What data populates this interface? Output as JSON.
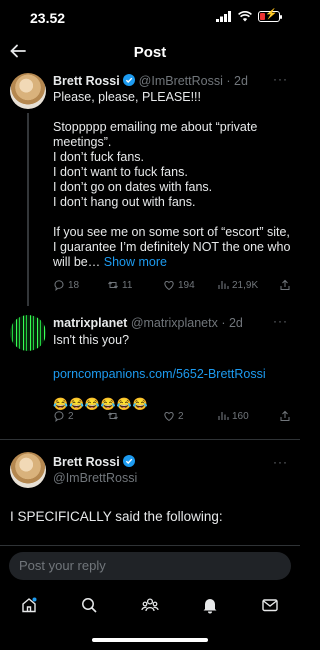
{
  "status": {
    "time": "23.52"
  },
  "header": {
    "title": "Post"
  },
  "post1": {
    "name": "Brett Rossi",
    "handle": "@ImBrettRossi",
    "time": "· 2d",
    "lines": [
      "Please, please, PLEASE!!!",
      "",
      "Stoppppp emailing me about “private",
      "meetings”.",
      "I don’t fuck fans.",
      "I don’t want to fuck fans.",
      "I don’t go on dates with fans.",
      "I don’t hang out with fans.",
      "",
      "If you see me on some sort of “escort” site,",
      "I guarantee I’m definitely NOT the one who"
    ],
    "last_line": "will be…",
    "show_more": "Show more",
    "stats": {
      "replies": "18",
      "reposts": "11",
      "likes": "194",
      "views": "21,9K"
    }
  },
  "post2": {
    "name": "matrixplanet",
    "handle": "@matrixplanetx",
    "time": "· 2d",
    "text": "Isn't this you?",
    "link": "porncompanions.com/5652-BrettRossi",
    "emojis": "😂😂😂😂😂😂",
    "stats": {
      "replies": "2",
      "reposts": "",
      "likes": "2",
      "views": "160"
    }
  },
  "post3": {
    "name": "Brett Rossi",
    "handle": "@ImBrettRossi",
    "text": "I SPECIFICALLY said the following:"
  },
  "composer": {
    "placeholder": "Post your reply"
  },
  "colors": {
    "background": "#000000",
    "accent": "#1d9bf0",
    "muted": "#71767b",
    "text": "#e7e9ea"
  },
  "icons": [
    "back-arrow-icon",
    "verified-icon",
    "more-icon",
    "reply-icon",
    "repost-icon",
    "like-icon",
    "views-icon",
    "bookmark-icon",
    "share-icon",
    "home-icon",
    "search-icon",
    "communities-icon",
    "notifications-icon",
    "messages-icon"
  ]
}
